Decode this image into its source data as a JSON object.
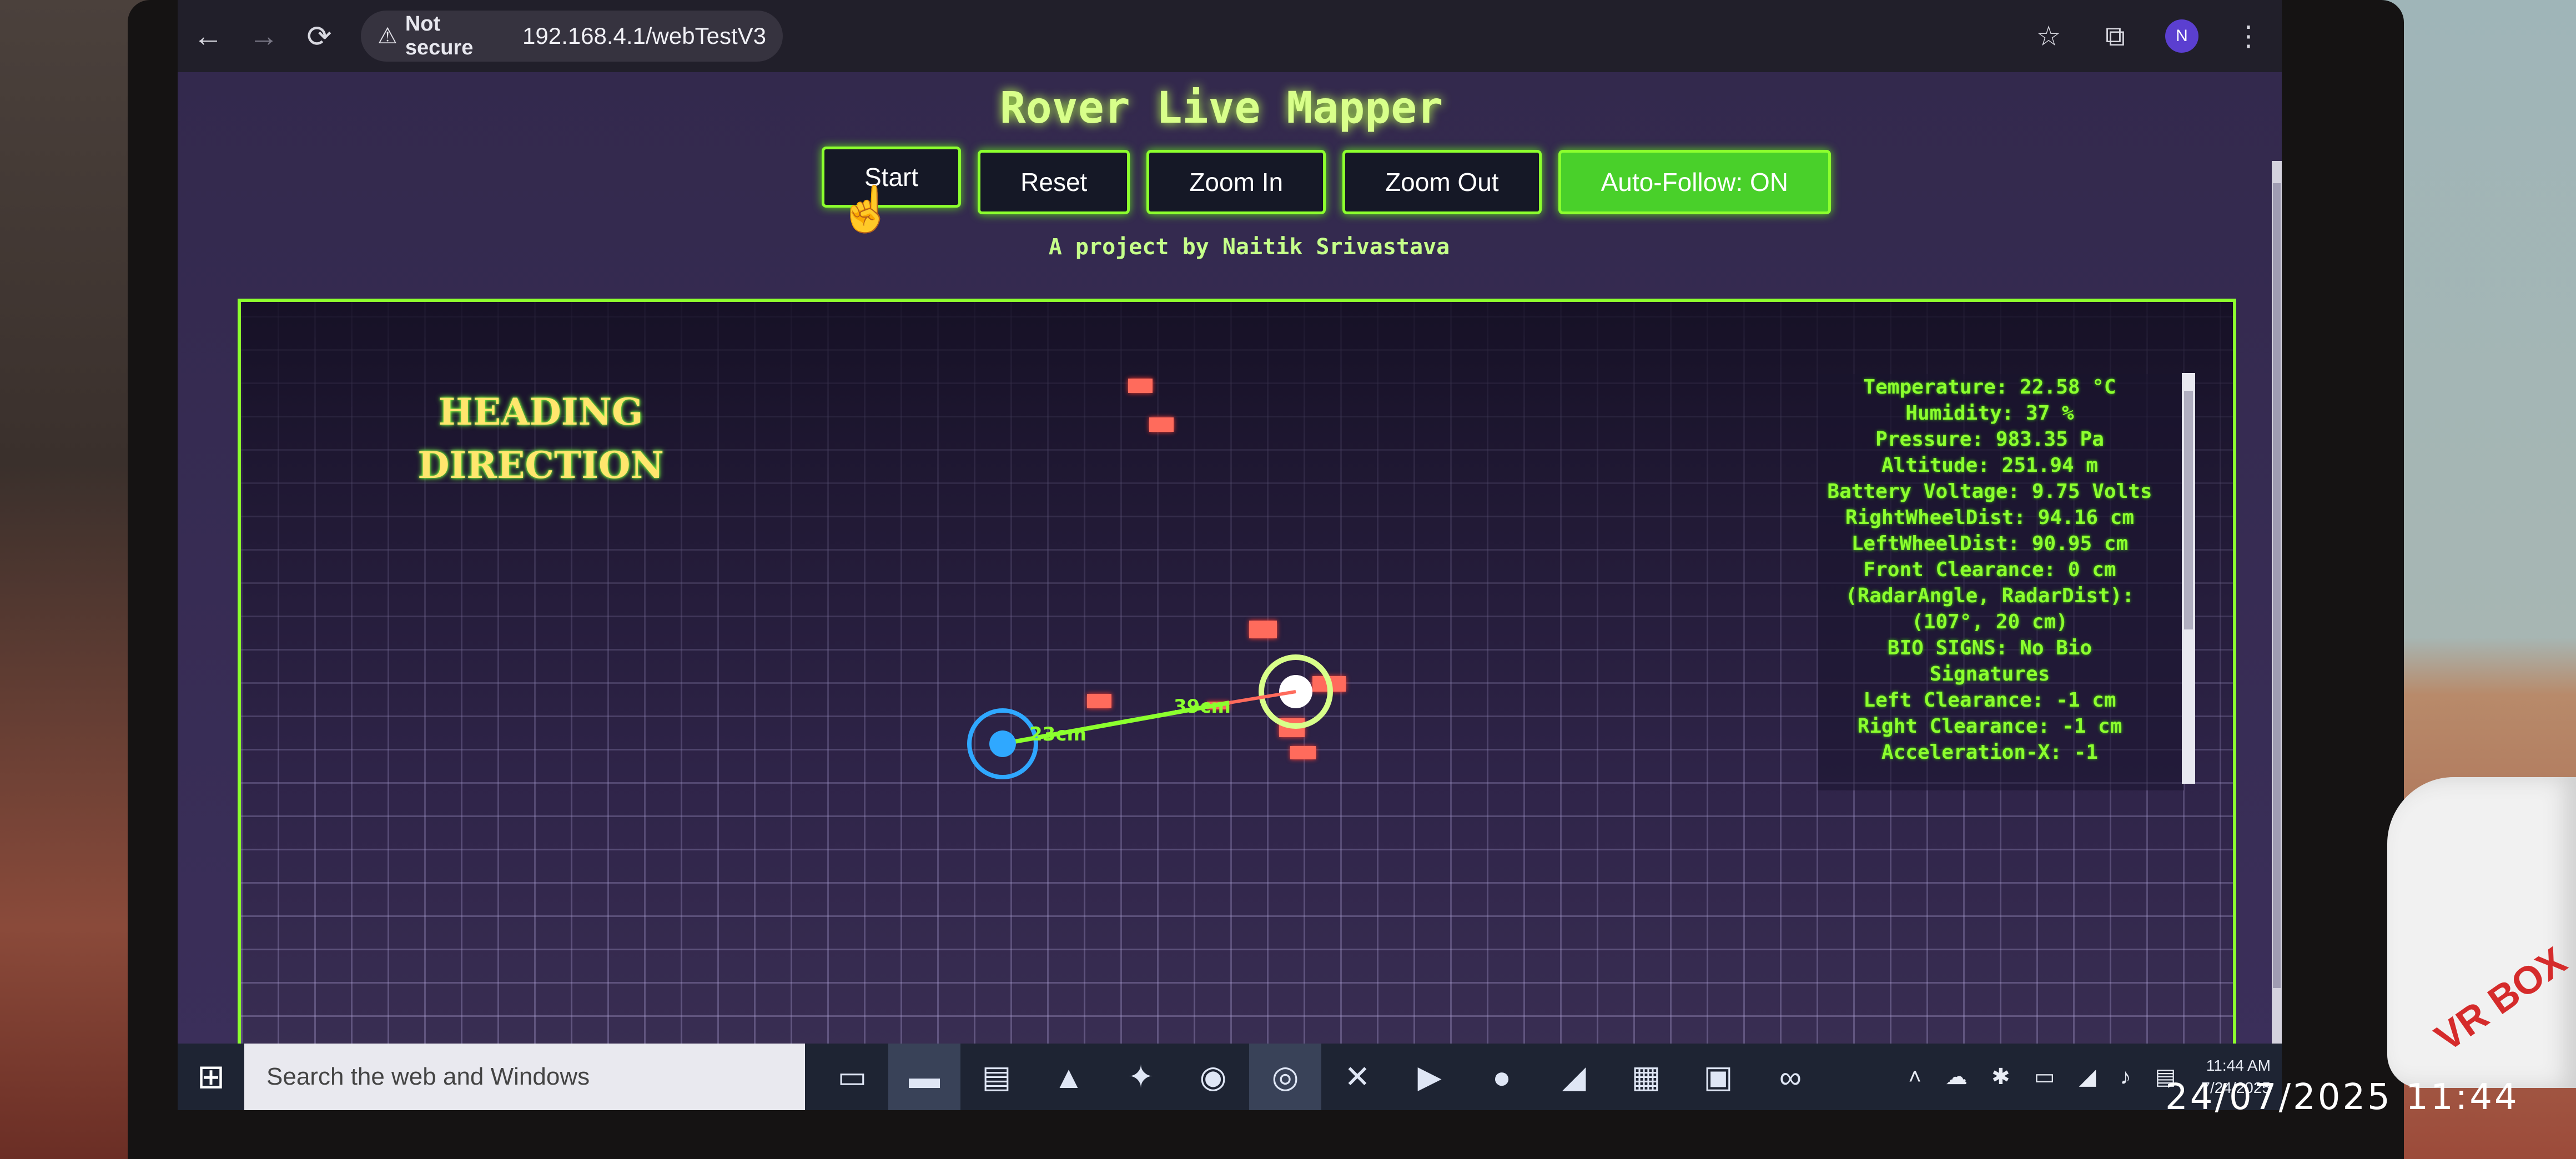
{
  "browser": {
    "security_label": "Not secure",
    "url": "192.168.4.1/webTestV3",
    "profile_initial": "N",
    "icons": [
      "back-icon",
      "forward-icon",
      "reload-icon",
      "star-icon",
      "extensions-icon",
      "menu-icon"
    ]
  },
  "page": {
    "title": "Rover Live Mapper",
    "buttons": [
      "Start",
      "Reset",
      "Zoom In",
      "Zoom Out",
      "Auto-Follow: ON"
    ],
    "subtitle": "A project by Naitik Srivastava"
  },
  "map": {
    "heading_line1": "HEADING",
    "heading_line2": "DIRECTION",
    "segment_labels": [
      "23cm",
      "39cm"
    ],
    "telemetry": [
      "Temperature: 22.58 °C",
      "Humidity: 37 %",
      "Pressure: 983.35 Pa",
      "Altitude: 251.94 m",
      "Battery Voltage: 9.75 Volts",
      "RightWheelDist: 94.16 cm",
      "LeftWheelDist: 90.95 cm",
      "Front Clearance: 0 cm",
      "(RadarAngle, RadarDist):",
      "(107°, 20 cm)",
      "BIO SIGNS: No Bio",
      "Signatures",
      "Left Clearance: -1 cm",
      "Right Clearance: -1 cm",
      "Acceleration-X: -1"
    ],
    "colors": {
      "accent": "#8cff2e",
      "obstacle": "#ff6b5c",
      "start_marker": "#2fa8ff",
      "rover_marker": "#d8ff8a"
    }
  },
  "taskbar": {
    "search_placeholder": "Search the web and Windows",
    "time": "11:44 AM",
    "date": "7/24/2025"
  },
  "photo_stamp": "24/07/2025  11:44",
  "device_label": "VR BOX"
}
